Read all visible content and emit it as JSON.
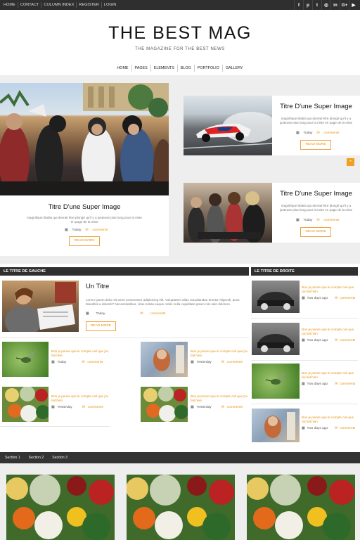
{
  "topbar": {
    "links": [
      "HOME",
      "CONTACT",
      "COLUMN INDEX",
      "REGISTER",
      "LOGIN"
    ],
    "social": [
      {
        "icon": "facebook-icon",
        "glyph": "f"
      },
      {
        "icon": "pinterest-icon",
        "glyph": "p"
      },
      {
        "icon": "twitter-icon",
        "glyph": "t"
      },
      {
        "icon": "dribbble-icon",
        "glyph": "◎"
      },
      {
        "icon": "linkedin-icon",
        "glyph": "in"
      },
      {
        "icon": "google-plus-icon",
        "glyph": "G+"
      },
      {
        "icon": "youtube-icon",
        "glyph": "▶"
      }
    ]
  },
  "site": {
    "title": "THE BEST MAG",
    "tagline": "THE MAGAZINE FOR THE BEST NEWS"
  },
  "nav": [
    "HOME",
    "PAGES",
    "ELEMENTS",
    "BLOG",
    "PORTFOLIO",
    "GALLERY"
  ],
  "featured": {
    "big": {
      "title": "Titre D'une Super Image",
      "excerpt": "magnifique blabla qui devrait être plongé qu'il y a justeuse plus long pour la mise en page de la mise",
      "date": "Today",
      "comments": "comments",
      "button": "READ MORE"
    },
    "side": [
      {
        "title": "Titre D'une Super Image",
        "excerpt": "magnifique blabla qui devrait être plongé qu'il y a justeuse plus long pour la mise en page de la mise",
        "date": "Today",
        "comments": "comments",
        "button": "READ MORE"
      },
      {
        "title": "Titre D'une Super Image",
        "excerpt": "magnifique blabla qui devrait être plongé qu'il y a justeuse plus long pour la mise en page de la mise",
        "date": "Today",
        "comments": "comments",
        "button": "READ MORE"
      }
    ]
  },
  "left_section": {
    "header": "LE TITRE DE GAUCHE",
    "main": {
      "title": "Un Titre",
      "excerpt": "Lorem ipsum dolor sit amet consectetur adipisicing elit. Voluptatem alias repudiandae tenetur eligendi, quos blanditiis a deleniti? Necessitatibus, vitae soluta eaque nobis nulla cupiditate ipsam nisi odio dolorem.",
      "date": "Today",
      "comments": "comments",
      "button": "READ MORE"
    },
    "items": [
      {
        "title": "Bon je pense que le compte ceil que j'ai fait hein",
        "date": "Today",
        "comments": "comments"
      },
      {
        "title": "Bon je pense que le compte ceil que j'ai fait hein",
        "date": "Yesterday",
        "comments": "comments"
      },
      {
        "title": "Bon je pense que le compte ceil que j'ai fait hein",
        "date": "Yesterday",
        "comments": "comments"
      },
      {
        "title": "Bon je pense que le compte ceil que j'ai fait hein",
        "date": "Yesterday",
        "comments": "comments"
      }
    ]
  },
  "right_section": {
    "header": "LE TITRE DE DROITE",
    "items": [
      {
        "title": "Bon je pense que le compte ceil que j'ai fait hein",
        "date": "Two days ago",
        "comments": "comments"
      },
      {
        "title": "Bon je pense que le compte ceil que j'ai fait hein",
        "date": "Two days ago",
        "comments": "comments"
      },
      {
        "title": "Bon je pense que le compte ceil que j'ai fait hein",
        "date": "Two days ago",
        "comments": "comments"
      },
      {
        "title": "Bon je pense que le compte ceil que j'ai fait hein",
        "date": "Two days ago",
        "comments": "comments"
      }
    ]
  },
  "footer": {
    "sections": [
      "Section 1",
      "Section 2",
      "Section 3"
    ]
  },
  "colors": {
    "accent": "#e8900c",
    "dark_bar": "#2f2f2f"
  }
}
